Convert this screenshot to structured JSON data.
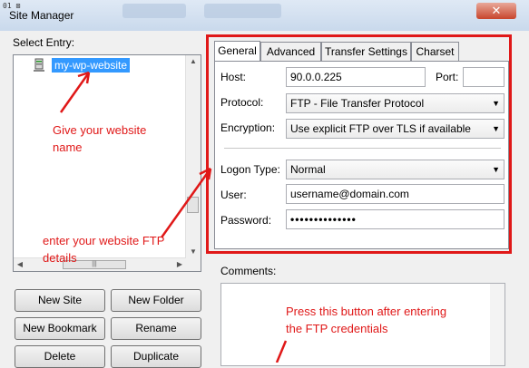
{
  "window": {
    "title": "Site Manager",
    "corner_icon_text": "01 ⊠",
    "close_label": "✕"
  },
  "select_entry": {
    "label": "Select Entry:",
    "selected_site": "my-wp-website"
  },
  "buttons": {
    "new_site": "New Site",
    "new_folder": "New Folder",
    "new_bookmark": "New Bookmark",
    "rename": "Rename",
    "delete": "Delete",
    "duplicate": "Duplicate"
  },
  "tabs": [
    "General",
    "Advanced",
    "Transfer Settings",
    "Charset"
  ],
  "active_tab": "General",
  "form": {
    "host_label": "Host:",
    "host_value": "90.0.0.225",
    "port_label": "Port:",
    "port_value": "",
    "protocol_label": "Protocol:",
    "protocol_value": "FTP - File Transfer Protocol",
    "encryption_label": "Encryption:",
    "encryption_value": "Use explicit FTP over TLS if available",
    "logon_type_label": "Logon Type:",
    "logon_type_value": "Normal",
    "user_label": "User:",
    "user_value": "username@domain.com",
    "password_label": "Password:",
    "password_value": "••••••••••••••"
  },
  "comments": {
    "label": "Comments:",
    "value": ""
  },
  "annotations": {
    "name_note_line1": "Give your website",
    "name_note_line2": "name",
    "ftp_note_line1": "enter your website FTP",
    "ftp_note_line2": "details",
    "button_note_line1": "Press this button after entering",
    "button_note_line2": "the FTP credentials"
  },
  "colors": {
    "annotation_red": "#e01818",
    "selection_blue": "#3399ff"
  }
}
